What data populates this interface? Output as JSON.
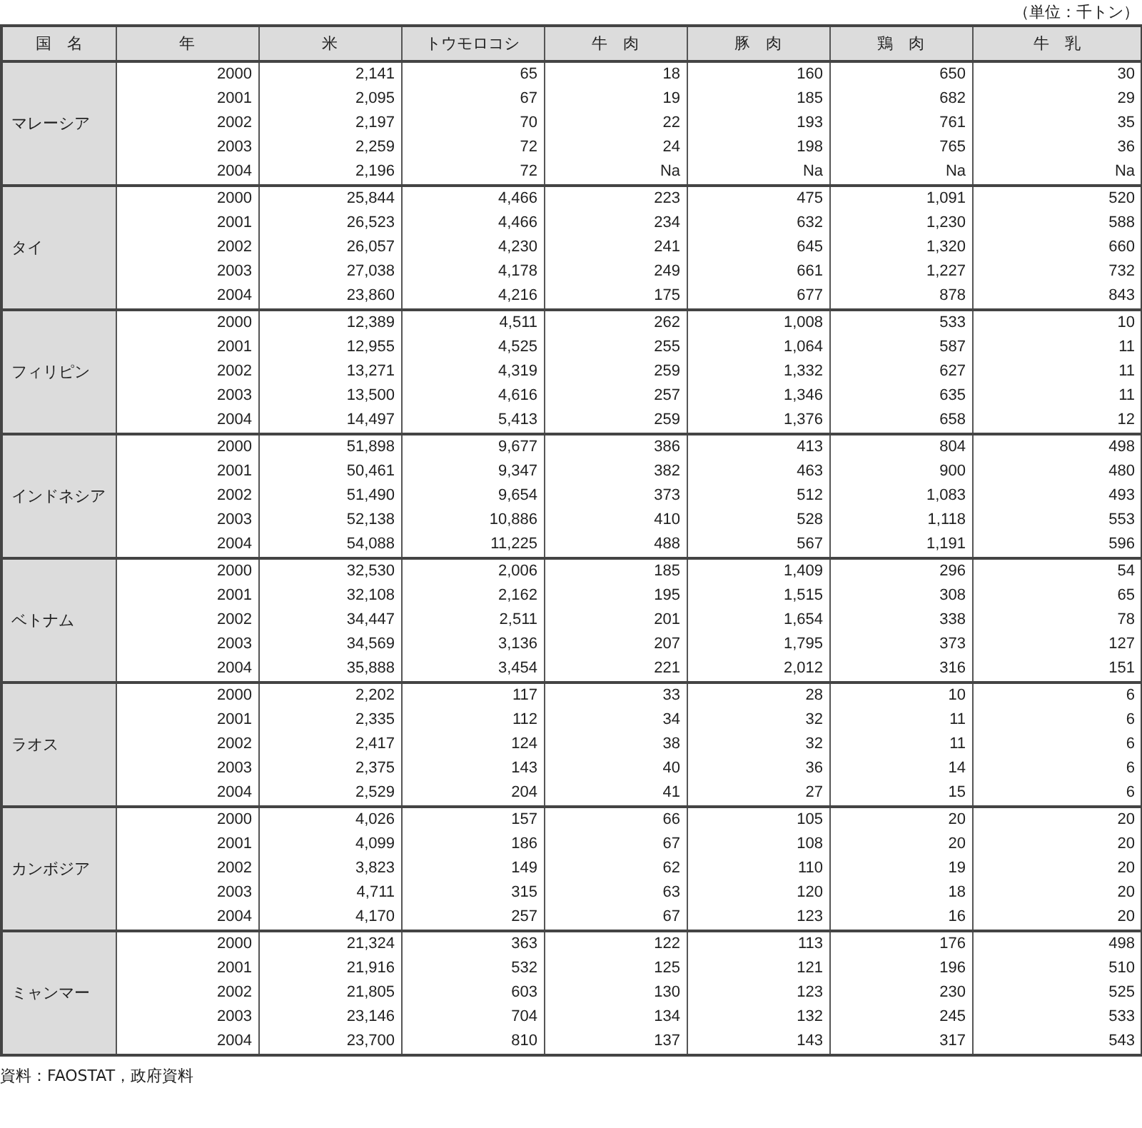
{
  "unit": "（単位：千トン）",
  "columns": [
    "国　名",
    "年",
    "米",
    "トウモロコシ",
    "牛　肉",
    "豚　肉",
    "鶏　肉",
    "牛　乳"
  ],
  "groups": [
    {
      "country": "マレーシア",
      "rows": [
        {
          "year": "2000",
          "values": [
            "2,141",
            "65",
            "18",
            "160",
            "650",
            "30"
          ]
        },
        {
          "year": "2001",
          "values": [
            "2,095",
            "67",
            "19",
            "185",
            "682",
            "29"
          ]
        },
        {
          "year": "2002",
          "values": [
            "2,197",
            "70",
            "22",
            "193",
            "761",
            "35"
          ]
        },
        {
          "year": "2003",
          "values": [
            "2,259",
            "72",
            "24",
            "198",
            "765",
            "36"
          ]
        },
        {
          "year": "2004",
          "values": [
            "2,196",
            "72",
            "Na",
            "Na",
            "Na",
            "Na"
          ]
        }
      ]
    },
    {
      "country": "タイ",
      "rows": [
        {
          "year": "2000",
          "values": [
            "25,844",
            "4,466",
            "223",
            "475",
            "1,091",
            "520"
          ]
        },
        {
          "year": "2001",
          "values": [
            "26,523",
            "4,466",
            "234",
            "632",
            "1,230",
            "588"
          ]
        },
        {
          "year": "2002",
          "values": [
            "26,057",
            "4,230",
            "241",
            "645",
            "1,320",
            "660"
          ]
        },
        {
          "year": "2003",
          "values": [
            "27,038",
            "4,178",
            "249",
            "661",
            "1,227",
            "732"
          ]
        },
        {
          "year": "2004",
          "values": [
            "23,860",
            "4,216",
            "175",
            "677",
            "878",
            "843"
          ]
        }
      ]
    },
    {
      "country": "フィリピン",
      "rows": [
        {
          "year": "2000",
          "values": [
            "12,389",
            "4,511",
            "262",
            "1,008",
            "533",
            "10"
          ]
        },
        {
          "year": "2001",
          "values": [
            "12,955",
            "4,525",
            "255",
            "1,064",
            "587",
            "11"
          ]
        },
        {
          "year": "2002",
          "values": [
            "13,271",
            "4,319",
            "259",
            "1,332",
            "627",
            "11"
          ]
        },
        {
          "year": "2003",
          "values": [
            "13,500",
            "4,616",
            "257",
            "1,346",
            "635",
            "11"
          ]
        },
        {
          "year": "2004",
          "values": [
            "14,497",
            "5,413",
            "259",
            "1,376",
            "658",
            "12"
          ]
        }
      ]
    },
    {
      "country": "インドネシア",
      "rows": [
        {
          "year": "2000",
          "values": [
            "51,898",
            "9,677",
            "386",
            "413",
            "804",
            "498"
          ]
        },
        {
          "year": "2001",
          "values": [
            "50,461",
            "9,347",
            "382",
            "463",
            "900",
            "480"
          ]
        },
        {
          "year": "2002",
          "values": [
            "51,490",
            "9,654",
            "373",
            "512",
            "1,083",
            "493"
          ]
        },
        {
          "year": "2003",
          "values": [
            "52,138",
            "10,886",
            "410",
            "528",
            "1,118",
            "553"
          ]
        },
        {
          "year": "2004",
          "values": [
            "54,088",
            "11,225",
            "488",
            "567",
            "1,191",
            "596"
          ]
        }
      ]
    },
    {
      "country": "ベトナム",
      "rows": [
        {
          "year": "2000",
          "values": [
            "32,530",
            "2,006",
            "185",
            "1,409",
            "296",
            "54"
          ]
        },
        {
          "year": "2001",
          "values": [
            "32,108",
            "2,162",
            "195",
            "1,515",
            "308",
            "65"
          ]
        },
        {
          "year": "2002",
          "values": [
            "34,447",
            "2,511",
            "201",
            "1,654",
            "338",
            "78"
          ]
        },
        {
          "year": "2003",
          "values": [
            "34,569",
            "3,136",
            "207",
            "1,795",
            "373",
            "127"
          ]
        },
        {
          "year": "2004",
          "values": [
            "35,888",
            "3,454",
            "221",
            "2,012",
            "316",
            "151"
          ]
        }
      ]
    },
    {
      "country": "ラオス",
      "rows": [
        {
          "year": "2000",
          "values": [
            "2,202",
            "117",
            "33",
            "28",
            "10",
            "6"
          ]
        },
        {
          "year": "2001",
          "values": [
            "2,335",
            "112",
            "34",
            "32",
            "11",
            "6"
          ]
        },
        {
          "year": "2002",
          "values": [
            "2,417",
            "124",
            "38",
            "32",
            "11",
            "6"
          ]
        },
        {
          "year": "2003",
          "values": [
            "2,375",
            "143",
            "40",
            "36",
            "14",
            "6"
          ]
        },
        {
          "year": "2004",
          "values": [
            "2,529",
            "204",
            "41",
            "27",
            "15",
            "6"
          ]
        }
      ]
    },
    {
      "country": "カンボジア",
      "rows": [
        {
          "year": "2000",
          "values": [
            "4,026",
            "157",
            "66",
            "105",
            "20",
            "20"
          ]
        },
        {
          "year": "2001",
          "values": [
            "4,099",
            "186",
            "67",
            "108",
            "20",
            "20"
          ]
        },
        {
          "year": "2002",
          "values": [
            "3,823",
            "149",
            "62",
            "110",
            "19",
            "20"
          ]
        },
        {
          "year": "2003",
          "values": [
            "4,711",
            "315",
            "63",
            "120",
            "18",
            "20"
          ]
        },
        {
          "year": "2004",
          "values": [
            "4,170",
            "257",
            "67",
            "123",
            "16",
            "20"
          ]
        }
      ]
    },
    {
      "country": "ミャンマー",
      "rows": [
        {
          "year": "2000",
          "values": [
            "21,324",
            "363",
            "122",
            "113",
            "176",
            "498"
          ]
        },
        {
          "year": "2001",
          "values": [
            "21,916",
            "532",
            "125",
            "121",
            "196",
            "510"
          ]
        },
        {
          "year": "2002",
          "values": [
            "21,805",
            "603",
            "130",
            "123",
            "230",
            "525"
          ]
        },
        {
          "year": "2003",
          "values": [
            "23,146",
            "704",
            "134",
            "132",
            "245",
            "533"
          ]
        },
        {
          "year": "2004",
          "values": [
            "23,700",
            "810",
            "137",
            "143",
            "317",
            "543"
          ]
        }
      ]
    }
  ],
  "source": "資料：FAOSTAT，政府資料"
}
